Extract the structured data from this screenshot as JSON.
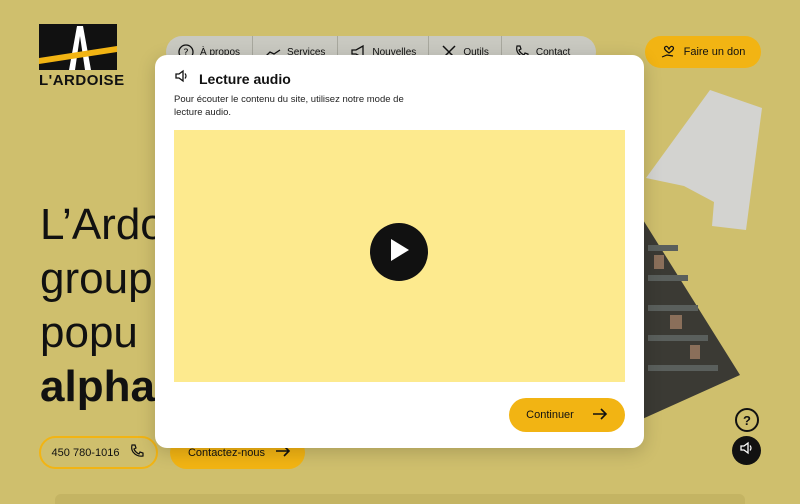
{
  "logo": {
    "text": "L'ARDOISE"
  },
  "nav": {
    "items": [
      {
        "label": "À propos",
        "icon": "question-icon"
      },
      {
        "label": "Services",
        "icon": "hands-icon"
      },
      {
        "label": "Nouvelles",
        "icon": "megaphone-icon"
      },
      {
        "label": "Outils",
        "icon": "tools-icon"
      },
      {
        "label": "Contact",
        "icon": "phone-icon"
      }
    ]
  },
  "donate": {
    "label": "Faire un don",
    "icon": "heart-hand-icon"
  },
  "hero": {
    "line1": "L’Ardo",
    "line2": "group",
    "line3": "popu",
    "line4": "alpha"
  },
  "actions": {
    "phone": "450 780-1016",
    "contact": "Contactez-nous"
  },
  "modal": {
    "title": "Lecture audio",
    "description": "Pour écouter le contenu du site, utilisez notre mode de lecture audio.",
    "continue_label": "Continuer"
  },
  "floating": {
    "help": "?"
  },
  "colors": {
    "background": "#cfbf6d",
    "accent": "#f2b413",
    "video_bg": "#fdea8e",
    "dark": "#111111"
  }
}
